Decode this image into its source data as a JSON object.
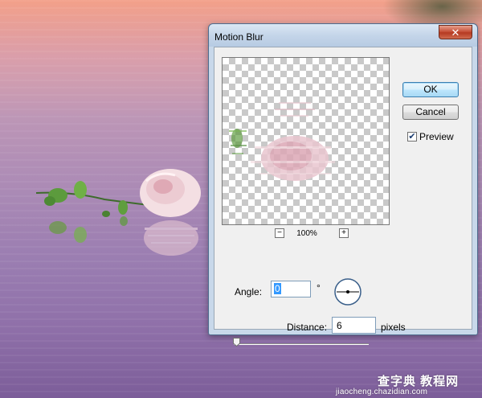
{
  "dialog": {
    "title": "Motion Blur",
    "close_icon": "close-x-icon",
    "close_glyph": "✕",
    "ok_label": "OK",
    "cancel_label": "Cancel",
    "preview_label": "Preview",
    "preview_checked": true,
    "preview_check_glyph": "✔",
    "zoom": {
      "minus_glyph": "−",
      "plus_glyph": "+",
      "value": "100%"
    },
    "angle": {
      "label": "Angle:",
      "value": "0",
      "unit": "°"
    },
    "distance": {
      "label": "Distance:",
      "value": "6",
      "unit": "pixels"
    }
  },
  "watermark": {
    "main": "查字典 教程网",
    "url": "jiaocheng.chazidian.com"
  },
  "colors": {
    "sky_top": "#f3a089",
    "water_bottom": "#7c5d99",
    "dialog_frame": "#c8d8ea",
    "close_button": "#c7523a",
    "ok_button_border": "#3c7fb1"
  }
}
